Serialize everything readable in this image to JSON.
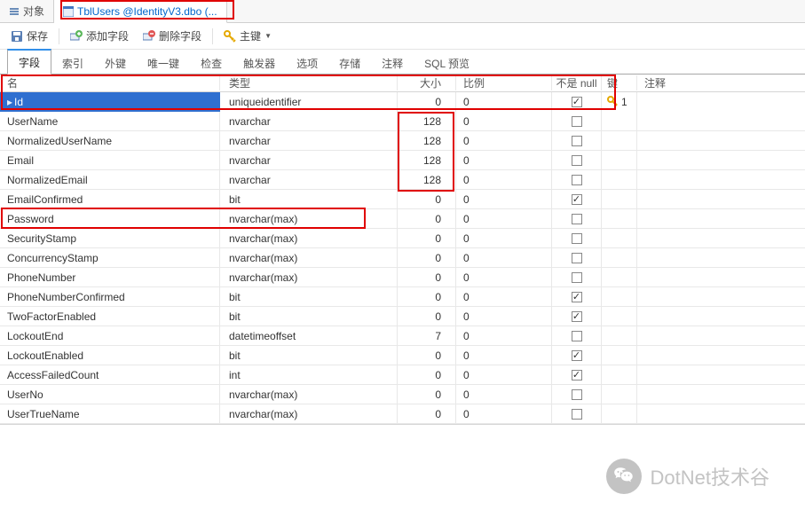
{
  "tabs": [
    {
      "label": "对象",
      "active": false
    },
    {
      "label": "TblUsers @IdentityV3.dbo (...",
      "active": true
    }
  ],
  "toolbar": {
    "save": "保存",
    "add_field": "添加字段",
    "delete_field": "删除字段",
    "primary_key": "主键"
  },
  "inner_tabs": [
    "字段",
    "索引",
    "外键",
    "唯一键",
    "检查",
    "触发器",
    "选项",
    "存储",
    "注释",
    "SQL 预览"
  ],
  "inner_tab_active": 0,
  "columns": {
    "name": "名",
    "type": "类型",
    "size": "大小",
    "scale": "比例",
    "not_null": "不是 null",
    "key": "键",
    "comment": "注释"
  },
  "fields": [
    {
      "name": "Id",
      "type": "uniqueidentifier",
      "size": "0",
      "scale": "0",
      "not_null": true,
      "key": 1,
      "selected": true
    },
    {
      "name": "UserName",
      "type": "nvarchar",
      "size": "128",
      "scale": "0",
      "not_null": false
    },
    {
      "name": "NormalizedUserName",
      "type": "nvarchar",
      "size": "128",
      "scale": "0",
      "not_null": false
    },
    {
      "name": "Email",
      "type": "nvarchar",
      "size": "128",
      "scale": "0",
      "not_null": false
    },
    {
      "name": "NormalizedEmail",
      "type": "nvarchar",
      "size": "128",
      "scale": "0",
      "not_null": false
    },
    {
      "name": "EmailConfirmed",
      "type": "bit",
      "size": "0",
      "scale": "0",
      "not_null": true
    },
    {
      "name": "Password",
      "type": "nvarchar(max)",
      "size": "0",
      "scale": "0",
      "not_null": false
    },
    {
      "name": "SecurityStamp",
      "type": "nvarchar(max)",
      "size": "0",
      "scale": "0",
      "not_null": false
    },
    {
      "name": "ConcurrencyStamp",
      "type": "nvarchar(max)",
      "size": "0",
      "scale": "0",
      "not_null": false
    },
    {
      "name": "PhoneNumber",
      "type": "nvarchar(max)",
      "size": "0",
      "scale": "0",
      "not_null": false
    },
    {
      "name": "PhoneNumberConfirmed",
      "type": "bit",
      "size": "0",
      "scale": "0",
      "not_null": true
    },
    {
      "name": "TwoFactorEnabled",
      "type": "bit",
      "size": "0",
      "scale": "0",
      "not_null": true
    },
    {
      "name": "LockoutEnd",
      "type": "datetimeoffset",
      "size": "7",
      "scale": "0",
      "not_null": false
    },
    {
      "name": "LockoutEnabled",
      "type": "bit",
      "size": "0",
      "scale": "0",
      "not_null": true
    },
    {
      "name": "AccessFailedCount",
      "type": "int",
      "size": "0",
      "scale": "0",
      "not_null": true
    },
    {
      "name": "UserNo",
      "type": "nvarchar(max)",
      "size": "0",
      "scale": "0",
      "not_null": false
    },
    {
      "name": "UserTrueName",
      "type": "nvarchar(max)",
      "size": "0",
      "scale": "0",
      "not_null": false
    }
  ],
  "watermark": "DotNet技术谷"
}
